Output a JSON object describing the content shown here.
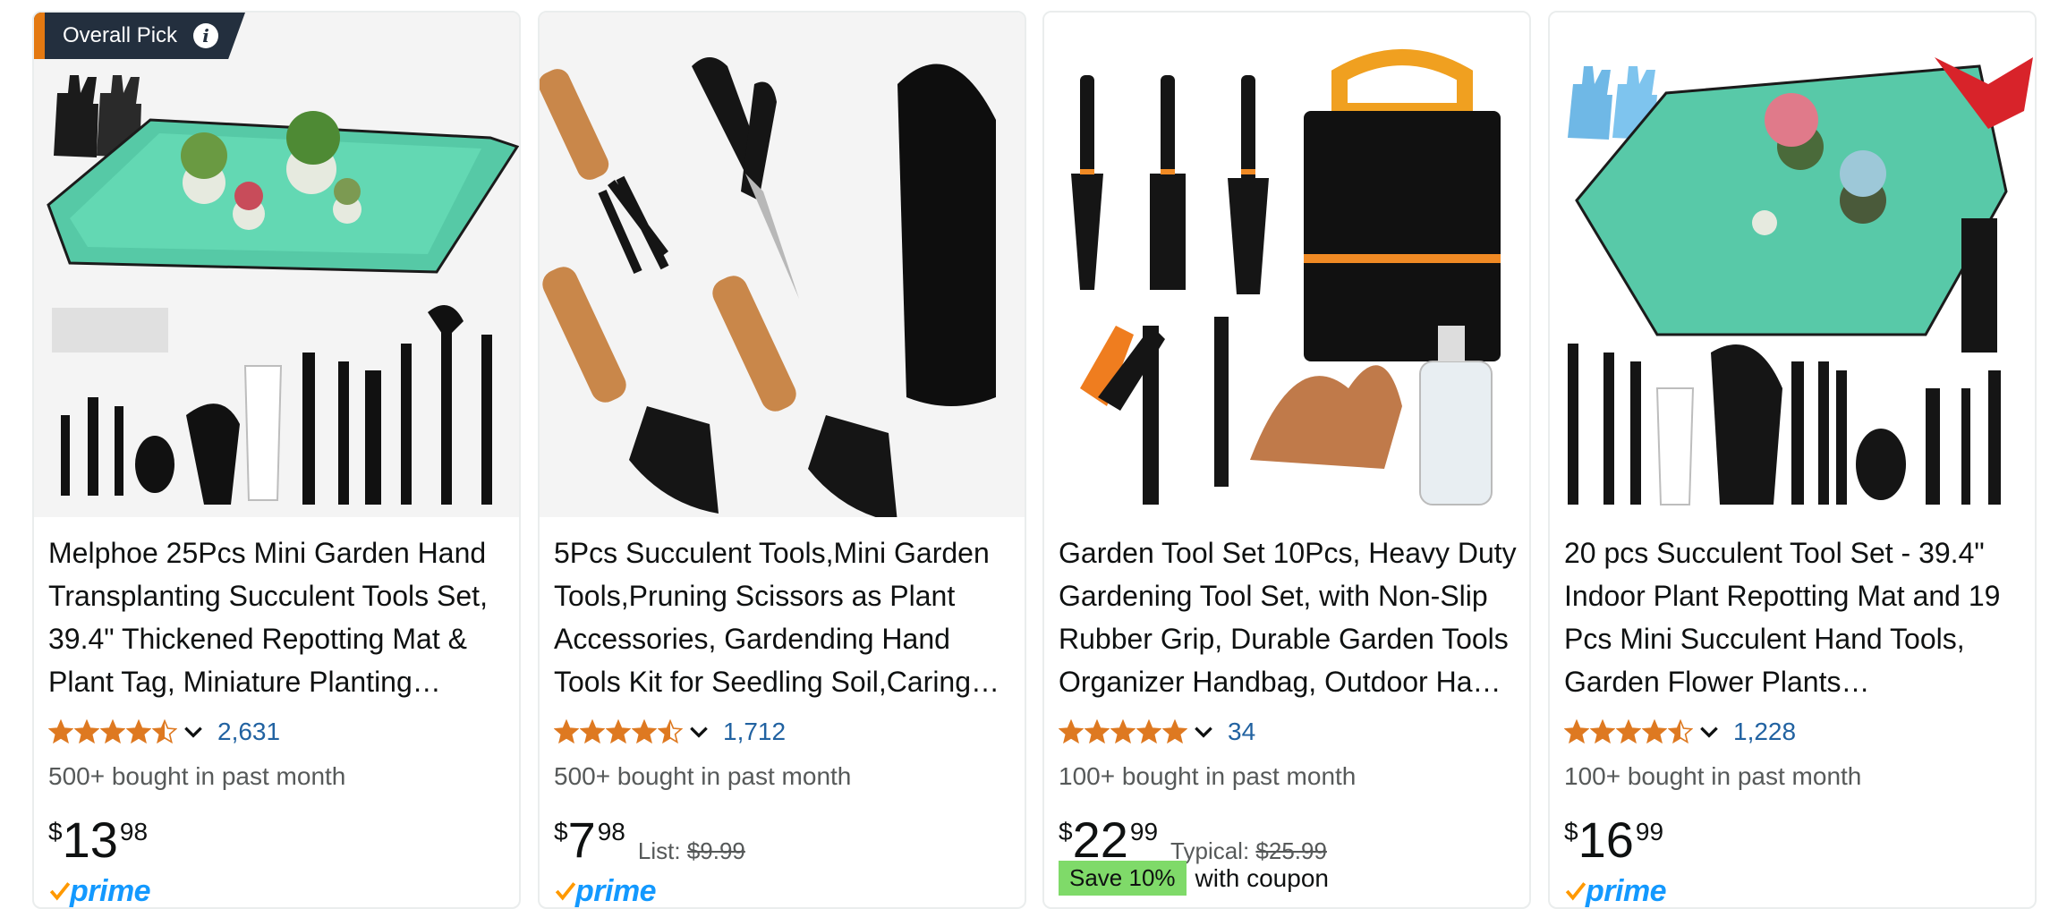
{
  "colors": {
    "star": "#de7921",
    "link": "#2162a1",
    "muted": "#565959",
    "prime": "#1399ff",
    "badge_bg": "#232f3e",
    "badge_accent": "#e47911",
    "coupon_bg": "#7fda69"
  },
  "products": [
    {
      "badge": "Overall Pick",
      "title": "Melphoe 25Pcs Mini Garden Hand Transplanting Succulent Tools Set, 39.4\" Thickened Repotting Mat & Plant Tag, Miniature Planting…",
      "rating": 4.5,
      "reviews": "2,631",
      "bought": "500+ bought in past month",
      "price": {
        "symbol": "$",
        "whole": "13",
        "fraction": "98"
      },
      "prime_label": "prime"
    },
    {
      "title": "5Pcs Succulent Tools,Mini Garden Tools,Pruning Scissors as Plant Accessories, Gardending Hand Tools Kit for Seedling Soil,Caring…",
      "rating": 4.5,
      "reviews": "1,712",
      "bought": "500+ bought in past month",
      "price": {
        "symbol": "$",
        "whole": "7",
        "fraction": "98"
      },
      "list_label": "List:",
      "list_price": "$9.99",
      "prime_label": "prime"
    },
    {
      "title": "Garden Tool Set 10Pcs, Heavy Duty Gardening Tool Set, with Non-Slip Rubber Grip, Durable Garden Tools Organizer Handbag, Outdoor Ha…",
      "rating": 5,
      "reviews": "34",
      "bought": "100+ bought in past month",
      "price": {
        "symbol": "$",
        "whole": "22",
        "fraction": "99"
      },
      "typical_label": "Typical:",
      "typical_price": "$25.99",
      "coupon_badge": "Save 10%",
      "coupon_text": "with coupon"
    },
    {
      "title": "20 pcs Succulent Tool Set - 39.4\" Indoor Plant Repotting Mat and 19 Pcs Mini Succulent Hand Tools, Garden Flower Plants…",
      "rating": 4.5,
      "reviews": "1,228",
      "bought": "100+ bought in past month",
      "price": {
        "symbol": "$",
        "whole": "16",
        "fraction": "99"
      },
      "prime_label": "prime"
    }
  ]
}
